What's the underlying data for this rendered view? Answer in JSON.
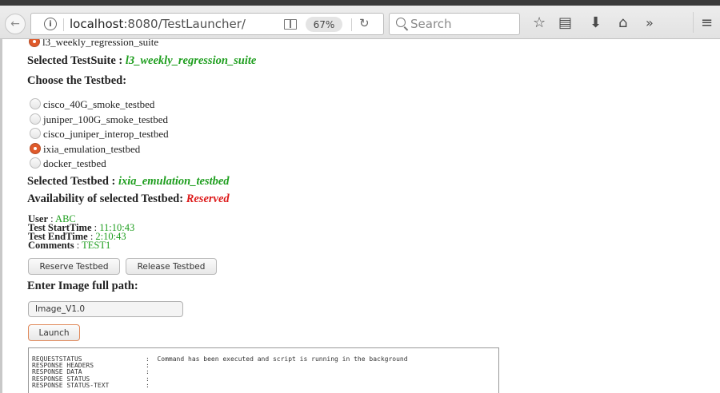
{
  "browser": {
    "url_host": "localhost",
    "url_path": ":8080/TestLauncher/",
    "zoom": "67%",
    "search_placeholder": "Search"
  },
  "page": {
    "suite_option_label": "l3_weekly_regression_suite",
    "selected_suite_label": "Selected TestSuite :",
    "selected_suite_value": "l3_weekly_regression_suite",
    "choose_testbed_heading": "Choose the Testbed:",
    "testbeds": [
      {
        "label": "cisco_40G_smoke_testbed",
        "checked": false
      },
      {
        "label": "juniper_100G_smoke_testbed",
        "checked": false
      },
      {
        "label": "cisco_juniper_interop_testbed",
        "checked": false
      },
      {
        "label": "ixia_emulation_testbed",
        "checked": true
      },
      {
        "label": "docker_testbed",
        "checked": false
      }
    ],
    "selected_testbed_label": "Selected Testbed :",
    "selected_testbed_value": "ixia_emulation_testbed",
    "availability_label": "Availability of selected Testbed:",
    "availability_value": "Reserved",
    "user_label": "User",
    "user_value": "ABC",
    "start_label": "Test StartTime",
    "start_value": "11:10:43",
    "end_label": "Test EndTime",
    "end_value": "2:10:43",
    "comments_label": "Comments",
    "comments_value": "TEST1",
    "reserve_button": "Reserve Testbed",
    "release_button": "Release Testbed",
    "image_heading": "Enter Image full path:",
    "image_value": "Image_V1.0",
    "launch_button": "Launch",
    "console_rows": [
      {
        "key": "REQUESTSTATUS",
        "sep": ":",
        "value": "Command has been executed and script is running in the background"
      },
      {
        "key": "RESPONSE HEADERS",
        "sep": ":",
        "value": ""
      },
      {
        "key": "RESPONSE DATA",
        "sep": ":",
        "value": ""
      },
      {
        "key": "RESPONSE STATUS",
        "sep": ":",
        "value": ""
      },
      {
        "key": "RESPONSE STATUS-TEXT",
        "sep": ":",
        "value": ""
      }
    ]
  }
}
